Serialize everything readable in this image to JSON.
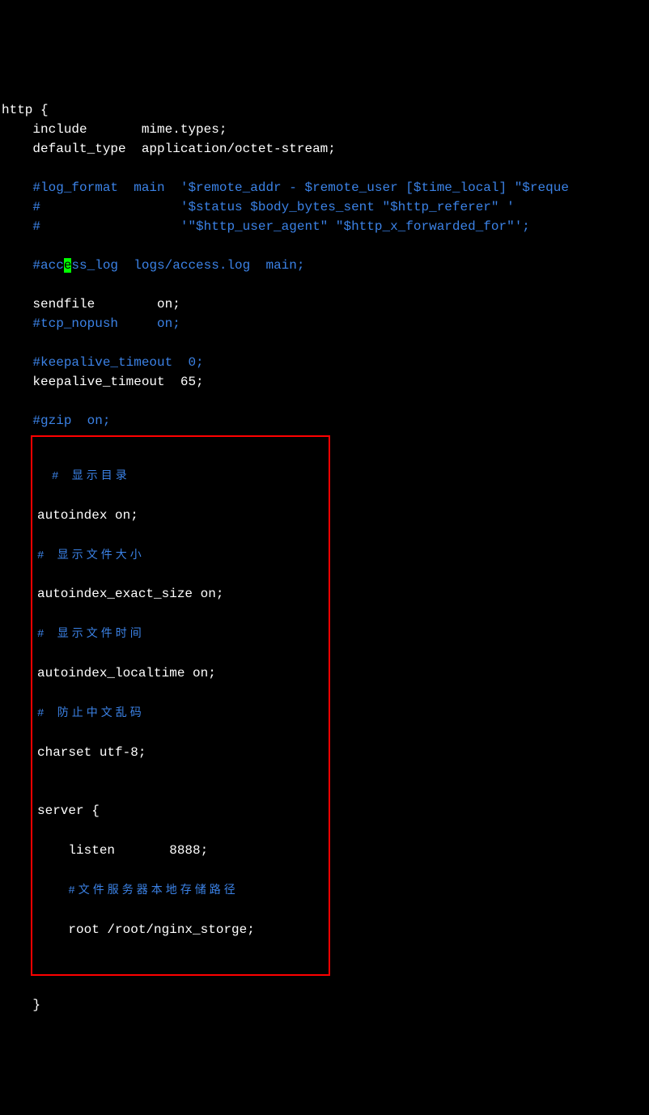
{
  "line1": "http {",
  "line2_indent": "    ",
  "line2_a": "include       mime.types;",
  "line3_a": "default_type  application/octet-stream;",
  "line4": "",
  "line5_c": "#log_format  main  '$remote_addr - $remote_user [$time_local] \"$reque",
  "line6_c": "#                  '$status $body_bytes_sent \"$http_referer\" '",
  "line7_c": "#                  '\"$http_user_agent\" \"$http_x_forwarded_for\"';",
  "line8": "",
  "line9_c1": "#acc",
  "line9_cursor": "e",
  "line9_c2": "ss_log  logs/access.log  main;",
  "line10": "",
  "line11_a": "sendfile        on;",
  "line12_c": "#tcp_nopush     on;",
  "line13": "",
  "line14_c": "#keepalive_timeout  0;",
  "line15_a": "keepalive_timeout  65;",
  "line16": "",
  "line17_c": "#gzip  on;",
  "box": {
    "c1": "# 显示目录",
    "l1": "autoindex on;",
    "c2": "# 显示文件大小",
    "l2": "autoindex_exact_size on;",
    "c3": "# 显示文件时间",
    "l3": "autoindex_localtime on;",
    "c4": "# 防止中文乱码",
    "l4": "charset utf-8;",
    "blank": "",
    "l5": "server {",
    "l6_indent": "    ",
    "l6": "listen       8888;",
    "c5_indent": "    ",
    "c5": "#文件服务器本地存储路径",
    "l7_indent": "    ",
    "l7": "root /root/nginx_storge;"
  },
  "last_line": "    }"
}
